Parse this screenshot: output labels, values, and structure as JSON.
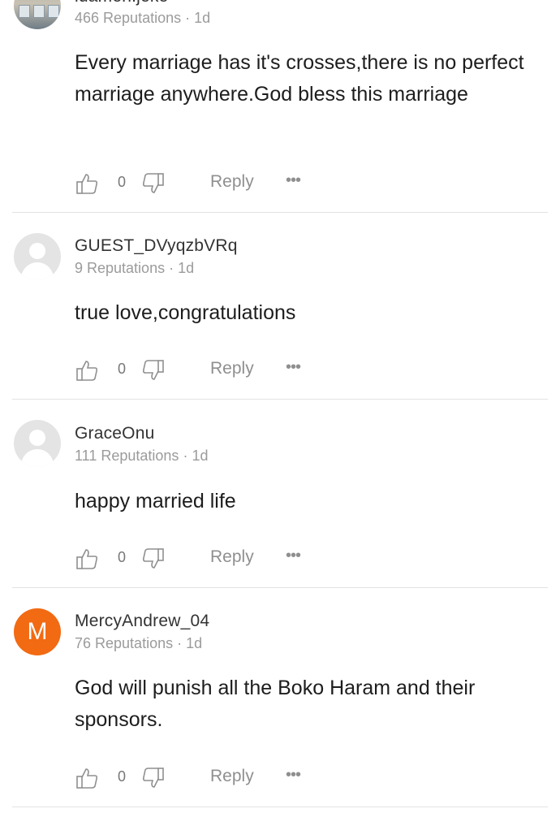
{
  "comments": [
    {
      "username": "idamen.jeke",
      "reputation": "466 Reputations",
      "time": "1d",
      "avatar_type": "photo",
      "text": "Every marriage has it's crosses,there is no perfect marriage anywhere.God bless this marriage",
      "likes": "0",
      "reply_label": "Reply",
      "more_label": "•••"
    },
    {
      "username": "GUEST_DVyqzbVRq",
      "reputation": "9 Reputations",
      "time": "1d",
      "avatar_type": "default",
      "text": "true love,congratulations",
      "likes": "0",
      "reply_label": "Reply",
      "more_label": "•••"
    },
    {
      "username": "GraceOnu",
      "reputation": "111 Reputations",
      "time": "1d",
      "avatar_type": "default",
      "text": "happy married life",
      "likes": "0",
      "reply_label": "Reply",
      "more_label": "•••"
    },
    {
      "username": "MercyAndrew_04",
      "reputation": "76 Reputations",
      "time": "1d",
      "avatar_type": "letter",
      "avatar_letter": "M",
      "text": "God will punish all the Boko Haram and their sponsors.",
      "likes": "0",
      "reply_label": "Reply",
      "more_label": "•••"
    }
  ],
  "meta_separator": " · ",
  "colors": {
    "letter_avatar": "#f26a12",
    "default_avatar": "#e4e4e4",
    "divider": "#e3e3e3"
  },
  "icons": {
    "like": "thumbs-up-icon",
    "dislike": "thumbs-down-icon",
    "more": "more-dots-icon"
  }
}
